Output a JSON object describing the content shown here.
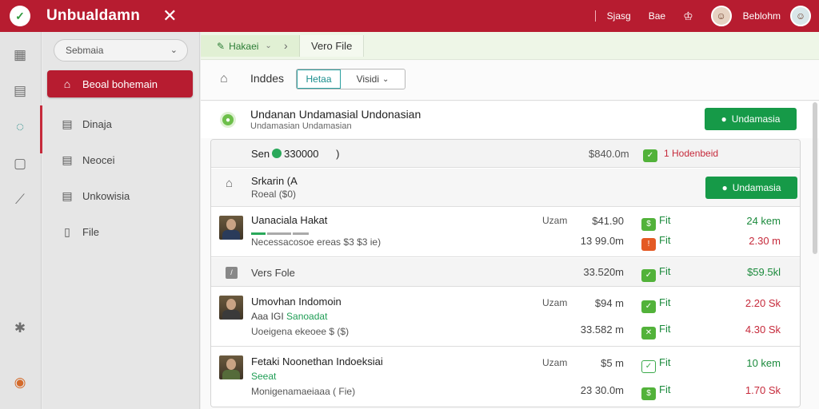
{
  "topbar": {
    "brand": "Unbualdamn",
    "close": "✕",
    "items": [
      "Sjasg",
      "Bae"
    ],
    "user_name": "Beblohm"
  },
  "sidebar": {
    "select_value": "Sebmaia",
    "items": [
      {
        "label": "Beoal bohemain",
        "icon": "building-icon",
        "active": true
      },
      {
        "label": "Dinaja",
        "icon": "document-icon",
        "active": false
      },
      {
        "label": "Neocei",
        "icon": "document-icon",
        "active": false
      },
      {
        "label": "Unkowisia",
        "icon": "document-icon",
        "active": false
      },
      {
        "label": "File",
        "icon": "file-icon",
        "active": false
      }
    ]
  },
  "breadcrumb": {
    "first": "Hakaei",
    "second": "Vero File"
  },
  "toolbar": {
    "title": "Inddes",
    "seg_active": "Hetaa",
    "seg_other": "Visidi"
  },
  "header": {
    "title": "Undanan Undamasial Undonasian",
    "subtitle": "Undamasian Undamasian",
    "button": "Undamasia"
  },
  "summary": {
    "left_pre": "Sen",
    "left_value": "330000",
    "left_post": ")",
    "mid": "$840.0m",
    "status": "1 Hodenbeid"
  },
  "group": {
    "title": "Srkarin (A",
    "subtitle": "Roeal ($0)",
    "button": "Undamasia"
  },
  "rows": [
    {
      "title": "Uanaciala Hakat",
      "sub_green": "",
      "sub": "Necessacosoe ereas $3 $3 ie)",
      "unit": "Uzam",
      "prices": [
        "$41.90",
        "13 99.0m"
      ],
      "flags": [
        "Fit",
        "Fit"
      ],
      "amounts": [
        "24 kem",
        "2.30 m"
      ]
    },
    {
      "title": "Vers Fole",
      "unit": "",
      "prices": [
        "33.520m"
      ],
      "flags": [
        "Fit"
      ],
      "amounts": [
        "$59.5kl"
      ]
    },
    {
      "title": "Umovhan Indomoin",
      "sub_green": "Sanoadat",
      "sub_prefix": "Aaa IGI",
      "sub": "Uoeigena ekeoee $ ($)",
      "unit": "Uzam",
      "prices": [
        "$94 m",
        "33.582 m"
      ],
      "flags": [
        "Fit",
        "Fit"
      ],
      "amounts": [
        "2.20 Sk",
        "4.30 Sk"
      ]
    },
    {
      "title": "Fetaki Noonethan Indoeksiai",
      "sub_green": "Seeat",
      "sub": "Monigenamaeiaaa ( Fie)",
      "unit": "Uzam",
      "prices": [
        "$5 m",
        "23 30.0m"
      ],
      "flags": [
        "Fit",
        "Fit"
      ],
      "amounts": [
        "10 kem",
        "1.70 Sk"
      ]
    }
  ],
  "colors": {
    "brand": "#b71c30",
    "green": "#169a48",
    "teal": "#1b8e8e"
  }
}
